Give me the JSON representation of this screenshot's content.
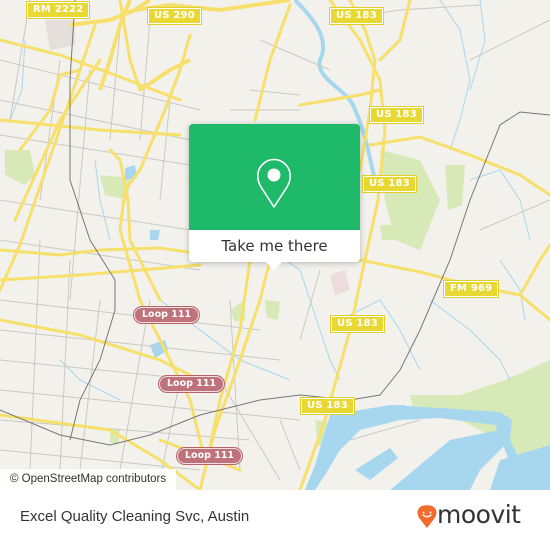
{
  "map": {
    "attribution": "© OpenStreetMap contributors",
    "colors": {
      "background": "#f2f1ec",
      "road_major": "#f6e06b",
      "road_minor": "#c9c8c4",
      "water": "#a6d7ee",
      "park": "#d8e9b8",
      "rail": "#777777"
    },
    "shields": [
      {
        "label": "RM 2222",
        "type": "highway"
      },
      {
        "label": "US 290",
        "type": "highway"
      },
      {
        "label": "US 183",
        "type": "highway"
      },
      {
        "label": "US 183",
        "type": "highway"
      },
      {
        "label": "US 183",
        "type": "highway"
      },
      {
        "label": "FM 969",
        "type": "highway"
      },
      {
        "label": "US 183",
        "type": "highway"
      },
      {
        "label": "US 183",
        "type": "highway"
      },
      {
        "label": "Loop 111",
        "type": "loop"
      },
      {
        "label": "Loop 111",
        "type": "loop"
      },
      {
        "label": "Loop 111",
        "type": "loop"
      }
    ]
  },
  "popup": {
    "icon": "map-pin-icon",
    "button_label": "Take me there",
    "accent_color": "#1fb96a"
  },
  "footer": {
    "place_name": "Excel Quality Cleaning Svc, Austin",
    "brand": "moovit",
    "brand_color": "#f26b2d"
  }
}
